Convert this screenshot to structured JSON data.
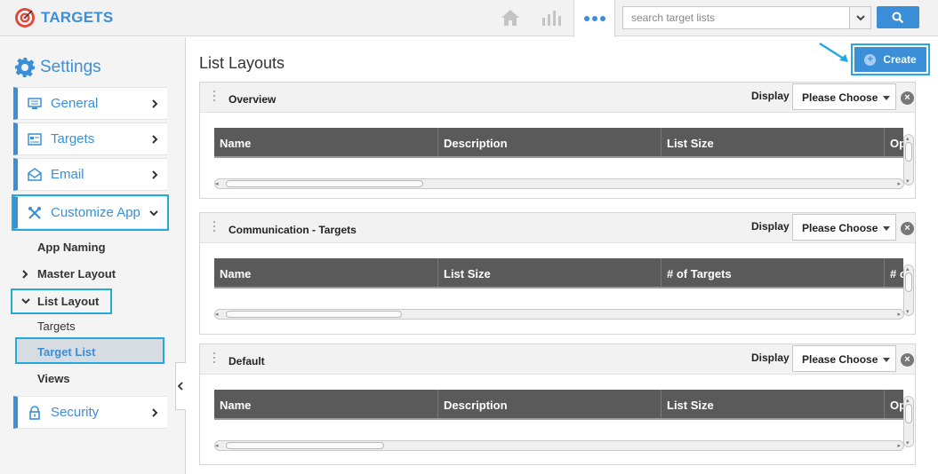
{
  "app": {
    "title": "TARGETS"
  },
  "topbar": {
    "icons": [
      "home-icon",
      "bar-chart-icon",
      "more-icon",
      "search-icon"
    ],
    "search_placeholder": "search target lists"
  },
  "sidebar": {
    "title": "Settings",
    "items": [
      {
        "label": "General",
        "icon": "monitor-icon"
      },
      {
        "label": "Targets",
        "icon": "list-icon"
      },
      {
        "label": "Email",
        "icon": "envelope-icon"
      },
      {
        "label": "Customize App",
        "icon": "tools-icon"
      },
      {
        "label": "Security",
        "icon": "lock-icon"
      }
    ],
    "sub_items": {
      "app_naming": "App Naming",
      "master_layout": "Master Layout",
      "list_layout": "List Layout",
      "targets": "Targets",
      "target_list": "Target List",
      "views": "Views"
    }
  },
  "main": {
    "title": "List Layouts",
    "create_label": "Create",
    "display_label": "Display",
    "display_value": "Please Choose",
    "panels": [
      {
        "name": "Overview",
        "columns": [
          "Name",
          "Description",
          "List Size",
          "Op"
        ]
      },
      {
        "name": "Communication - Targets",
        "columns": [
          "Name",
          "List Size",
          "# of Targets",
          "# o"
        ]
      },
      {
        "name": "Default",
        "columns": [
          "Name",
          "Description",
          "List Size",
          "Op"
        ]
      }
    ]
  },
  "colors": {
    "accent": "#3b8ed8",
    "highlight": "#22a9e0",
    "grid_header": "#5a5a5a"
  }
}
